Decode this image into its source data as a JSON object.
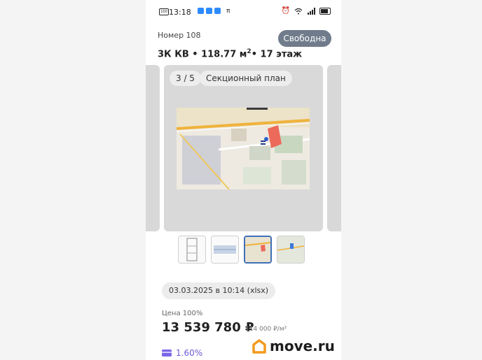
{
  "status_bar": {
    "time": "13:18",
    "battery_label": "100",
    "pi_symbol": "π"
  },
  "unit": {
    "number_label": "Номер 108",
    "status": "Свободна",
    "title_prefix": "3К КВ • 118.77 м",
    "title_sup": "2",
    "title_suffix": "• 17 этаж"
  },
  "gallery": {
    "counter": "3 / 5",
    "plan_type": "Секционный план",
    "thumb_count": 4,
    "active_index": 2
  },
  "listing": {
    "date": "03.03.2025 в 10:14 (xlsx)",
    "price_label": "Цена 100%",
    "price": "13 539 780 ₽",
    "price_per_m2": "114 000 ₽/м²",
    "rate": "1.60%"
  },
  "watermark": {
    "logo_text": "move.ru"
  },
  "colors": {
    "status_chip": "#707b8b",
    "accent": "#3d6fb7",
    "rate": "#6a5ad8",
    "logo": "#f39a1e"
  }
}
